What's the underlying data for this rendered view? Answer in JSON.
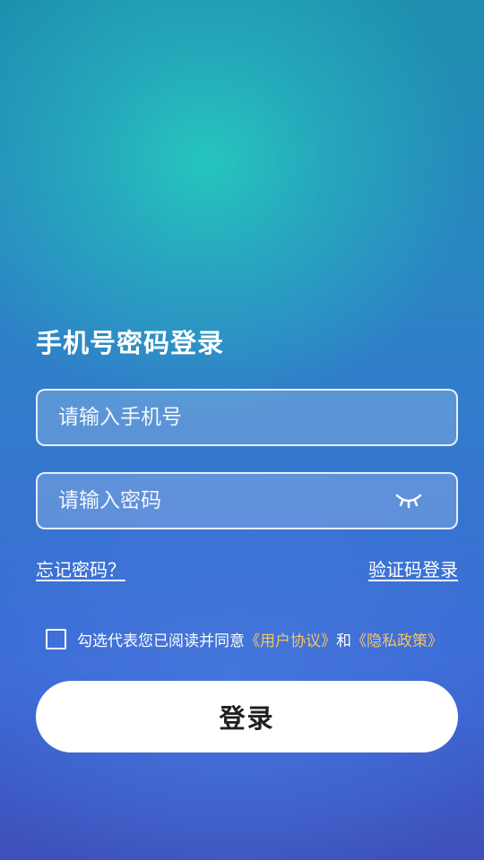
{
  "title": "手机号密码登录",
  "phone": {
    "placeholder": "请输入手机号",
    "value": ""
  },
  "password": {
    "placeholder": "请输入密码",
    "value": "",
    "toggle_icon": "eye-closed-icon"
  },
  "links": {
    "forgot_password": "忘记密码？",
    "sms_login": "验证码登录"
  },
  "agreement": {
    "checked": false,
    "prefix": "勾选代表您已阅读并同意",
    "user_agreement": "《用户协议》",
    "conjunction": "和",
    "privacy_policy": "《隐私政策》"
  },
  "login_button": "登录",
  "colors": {
    "link_accent": "#f3c36a",
    "button_bg": "#ffffff",
    "text": "#ffffff"
  }
}
